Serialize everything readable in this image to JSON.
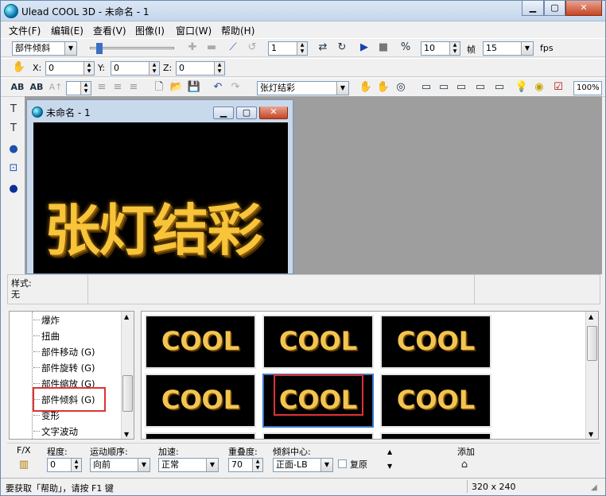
{
  "window": {
    "title": "Ulead COOL 3D - 未命名 - 1"
  },
  "menu": [
    "文件(F)",
    "编辑(E)",
    "查看(V)",
    "图像(I)",
    "窗口(W)",
    "帮助(H)"
  ],
  "toolbar1": {
    "effect_select": "部件倾斜",
    "frame_value": "1",
    "frames_total": "10",
    "frames_label": "帧",
    "fps_value": "15",
    "fps_label": "fps"
  },
  "toolbar2": {
    "x_label": "X:",
    "x_value": "0",
    "y_label": "Y:",
    "y_value": "0",
    "z_label": "Z:",
    "z_value": "0"
  },
  "toolbar3": {
    "text_object_select": "张灯结彩",
    "zoom": "100%"
  },
  "document": {
    "title": "未命名 - 1",
    "canvas_text": "张灯结彩"
  },
  "style_panel": {
    "label": "样式:",
    "value": "无"
  },
  "tree": {
    "items": [
      "爆炸",
      "扭曲",
      "部件移动 (G)",
      "部件旋转 (G)",
      "部件缩放 (G)",
      "部件倾斜 (G)",
      "变形",
      "文字波动"
    ],
    "selected": "部件倾斜 (G)"
  },
  "gallery": {
    "thumbnail_label": "COOL"
  },
  "props": {
    "fx_label": "F/X",
    "degree_label": "程度:",
    "degree_value": "0",
    "order_label": "运动顺序:",
    "order_value": "向前",
    "accel_label": "加速:",
    "accel_value": "正常",
    "overlap_label": "重叠度:",
    "overlap_value": "70",
    "tilt_center_label": "倾斜中心:",
    "tilt_center_value": "正面-LB",
    "restore_label": "复原",
    "add_label": "添加"
  },
  "status": {
    "hint": "要获取「帮助」，请按 F1 键",
    "size": "320 x 240"
  },
  "colors": {
    "highlight_box": "#dd3333",
    "canvas_bg": "#000000",
    "text_gold": "#f7c43a"
  }
}
